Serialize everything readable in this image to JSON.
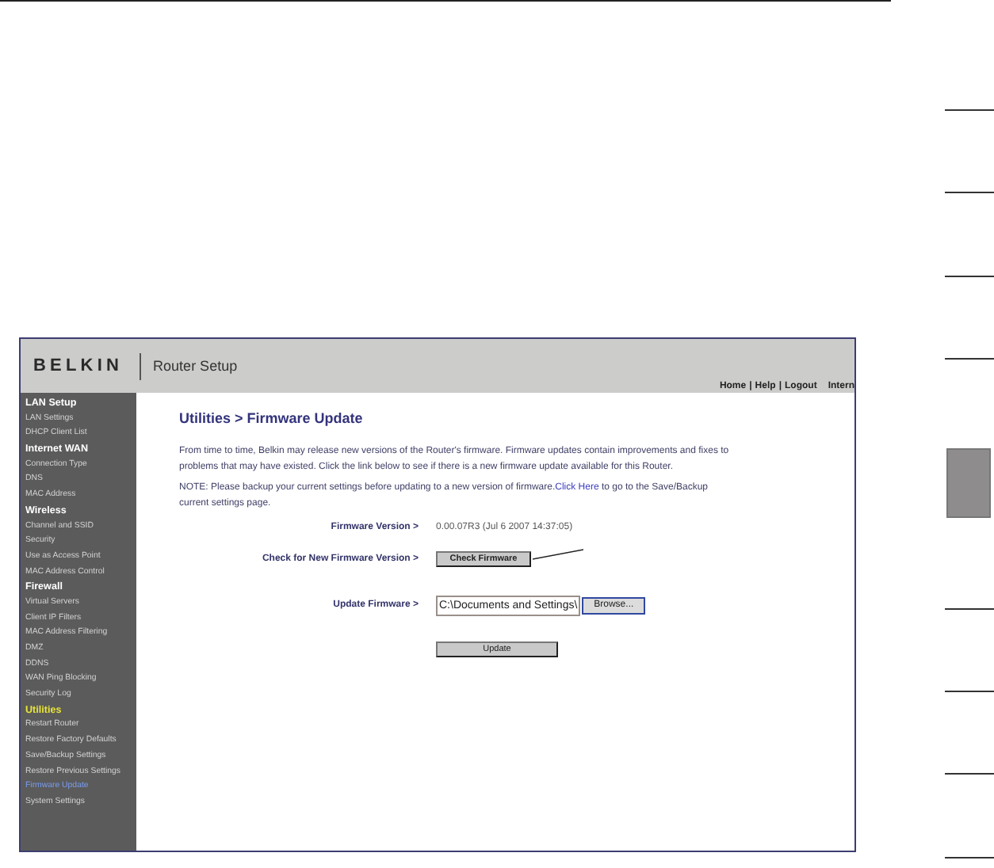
{
  "page_tabs": [
    {
      "selected": false
    },
    {
      "selected": false
    },
    {
      "selected": false
    },
    {
      "selected": false
    },
    {
      "selected": true
    },
    {
      "selected": false
    },
    {
      "selected": false
    },
    {
      "selected": false
    },
    {
      "selected": false
    }
  ],
  "screenshot": {
    "header": {
      "logo": "BELKIN",
      "title": "Router Setup",
      "nav": [
        {
          "kind": "link",
          "text": "Home"
        },
        {
          "kind": "separator",
          "text": "|"
        },
        {
          "kind": "link",
          "text": "Help"
        },
        {
          "kind": "separator",
          "text": "|"
        },
        {
          "kind": "link",
          "text": "Logout"
        },
        {
          "kind": "link",
          "text": "Intern"
        }
      ]
    },
    "sidebar": {
      "sections": [
        {
          "label": "LAN Setup",
          "selected": false,
          "items": [
            {
              "label": "LAN Settings",
              "selected": false
            },
            {
              "label": "DHCP Client List",
              "selected": false
            }
          ]
        },
        {
          "label": "Internet WAN",
          "selected": false,
          "items": [
            {
              "label": "Connection Type",
              "selected": false
            },
            {
              "label": "DNS",
              "selected": false
            },
            {
              "label": "MAC Address",
              "selected": false
            }
          ]
        },
        {
          "label": "Wireless",
          "selected": false,
          "items": [
            {
              "label": "Channel and SSID",
              "selected": false
            },
            {
              "label": "Security",
              "selected": false
            },
            {
              "label": "Use as Access Point",
              "selected": false
            },
            {
              "label": "MAC Address Control",
              "selected": false
            }
          ]
        },
        {
          "label": "Firewall",
          "selected": false,
          "items": [
            {
              "label": "Virtual Servers",
              "selected": false
            },
            {
              "label": "Client IP Filters",
              "selected": false
            },
            {
              "label": "MAC Address Filtering",
              "selected": false
            },
            {
              "label": "DMZ",
              "selected": false
            },
            {
              "label": "DDNS",
              "selected": false
            },
            {
              "label": "WAN Ping Blocking",
              "selected": false
            },
            {
              "label": "Security Log",
              "selected": false
            }
          ]
        },
        {
          "label": "Utilities",
          "selected": true,
          "items": [
            {
              "label": "Restart Router",
              "selected": false
            },
            {
              "label": "Restore Factory Defaults",
              "selected": false
            },
            {
              "label": "Save/Backup Settings",
              "selected": false
            },
            {
              "label": "Restore Previous Settings",
              "selected": false
            },
            {
              "label": "Firmware Update",
              "selected": true
            },
            {
              "label": "System Settings",
              "selected": false
            }
          ]
        }
      ]
    },
    "content": {
      "title": "Utilities > Firmware Update",
      "intro": "From time to time, Belkin may release new versions of the Router's firmware. Firmware updates contain improvements and fixes to problems that may have existed. Click the link below to see if there is a new firmware update available for this Router.",
      "note": {
        "before": "NOTE: Please backup your current settings before updating to a new version of firmware.",
        "link": "Click Here",
        "after": " to go to the Save/Backup current settings page."
      },
      "rows": [
        {
          "kind": "value",
          "label": "Firmware Version >",
          "value": "0.00.07R3 (Jul 6 2007 14:37:05)"
        },
        {
          "kind": "button",
          "label": "Check for New Firmware Version >",
          "button": "Check Firmware"
        },
        {
          "kind": "file",
          "label": "Update Firmware >",
          "value": "C:\\Documents and Settings\\",
          "button": "Browse..."
        },
        {
          "kind": "submit",
          "button": "Update"
        }
      ]
    }
  }
}
